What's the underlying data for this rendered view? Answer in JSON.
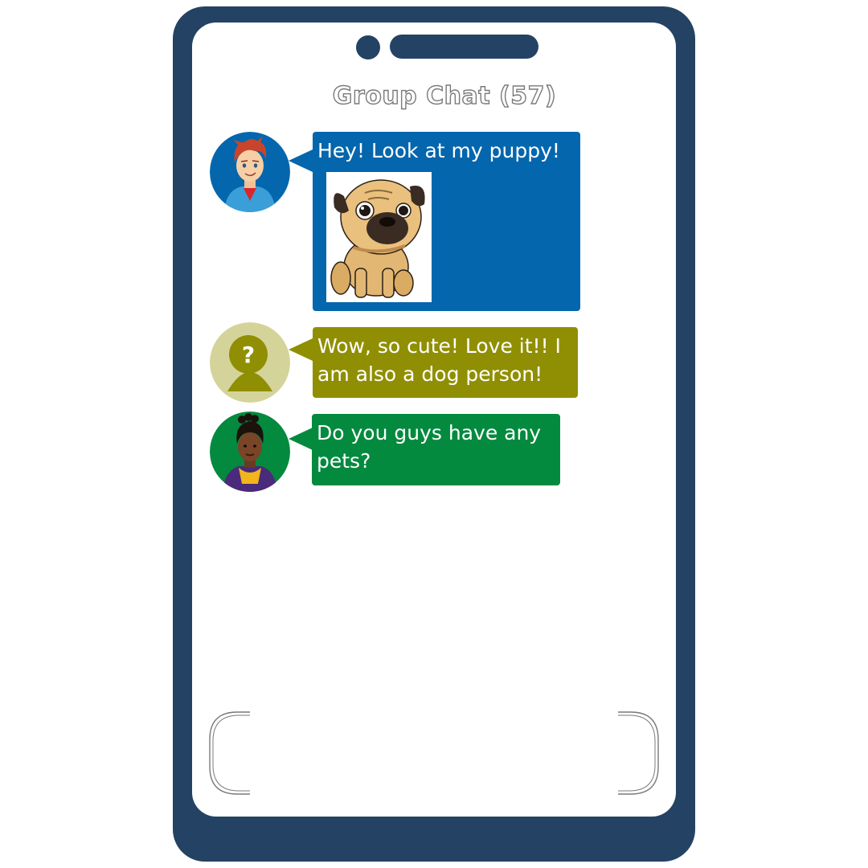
{
  "chat": {
    "title": "Group Chat (57)",
    "messages": [
      {
        "sender_avatar": "red-haired-boy-avatar",
        "text": "Hey! Look at my puppy!",
        "attachment": "pug-puppy-image",
        "color": "#0466ad"
      },
      {
        "sender_avatar": "unknown-user-avatar",
        "text": "Wow, so cute! Love it!! I am also a dog person!",
        "color": "#908f03"
      },
      {
        "sender_avatar": "braided-hair-woman-avatar",
        "text": "Do you guys have any pets?",
        "color": "#038a3e"
      }
    ]
  },
  "colors": {
    "phone_frame": "#244263",
    "screen": "#ffffff",
    "unknown_avatar_bg": "#d4d49a",
    "unknown_avatar_fg": "#908f03"
  }
}
